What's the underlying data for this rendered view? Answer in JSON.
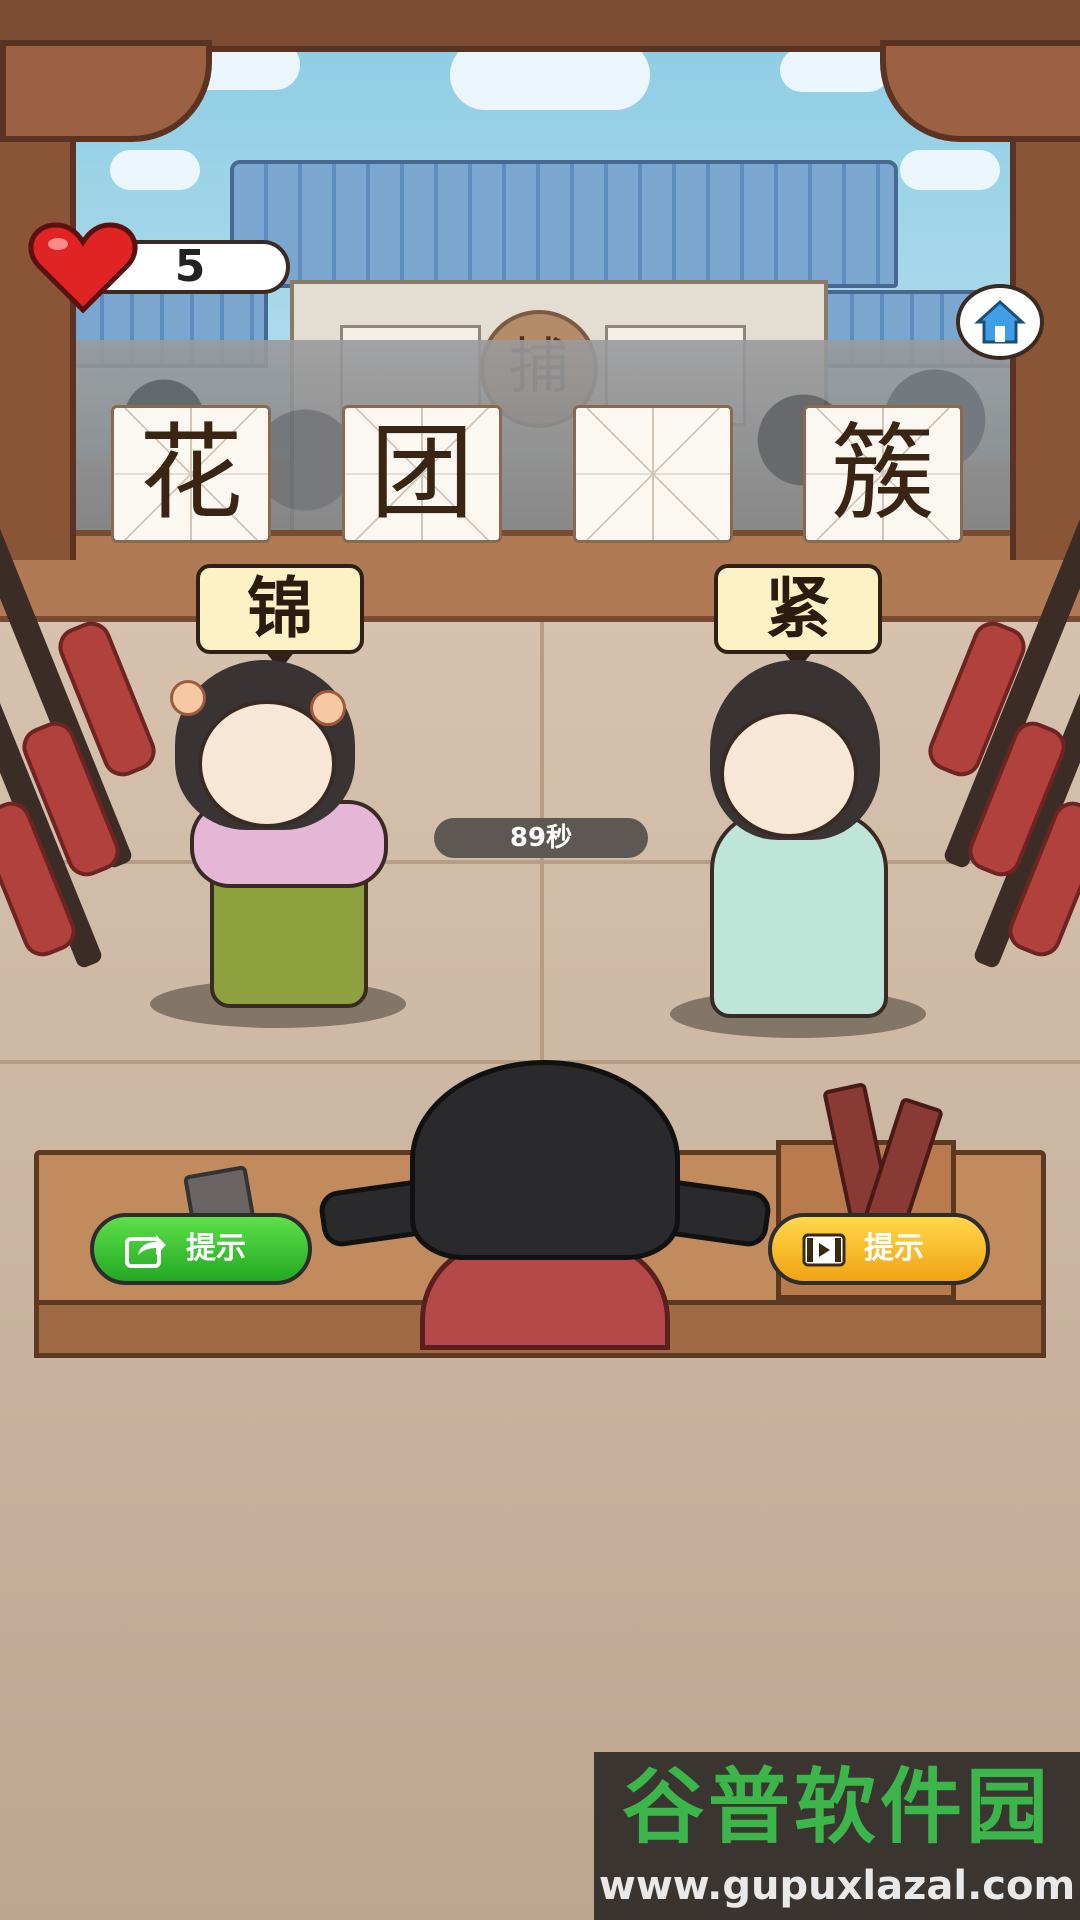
{
  "status": {
    "lives": "5",
    "timer": "89秒"
  },
  "idiom": {
    "slots": [
      "花",
      "团",
      "",
      "簇"
    ]
  },
  "choices": {
    "left": "锦",
    "right": "紧"
  },
  "hints": {
    "share_label": "提示",
    "video_label": "提示"
  },
  "scene": {
    "seal_text": "捕"
  },
  "watermark": {
    "title": "谷普软件园",
    "url": "www.gupuxlazal.com"
  },
  "colors": {
    "accent_green": "#22a823",
    "accent_yellow": "#f0a313",
    "heart_red": "#e02424"
  },
  "icons": [
    "heart-icon",
    "home-icon",
    "share-icon",
    "video-icon"
  ]
}
